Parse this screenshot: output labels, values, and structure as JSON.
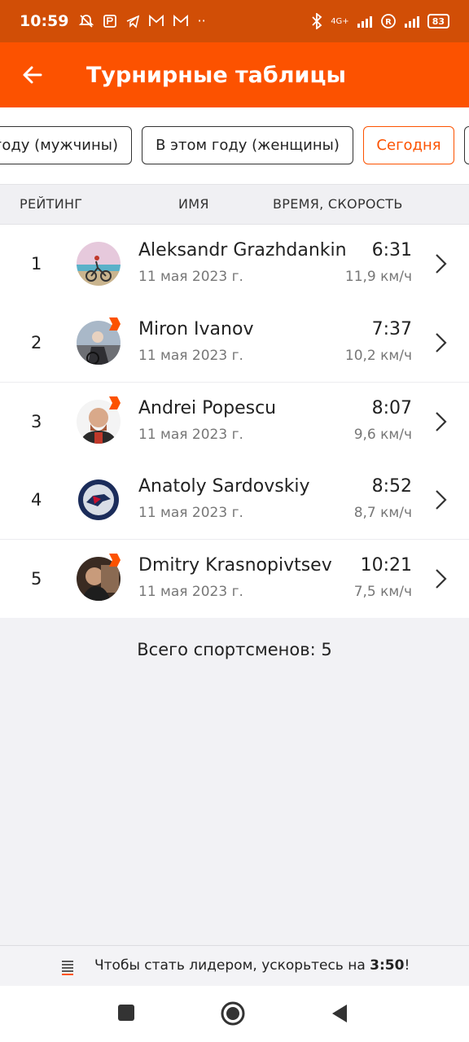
{
  "status_bar": {
    "time": "10:59",
    "network": "4G+",
    "battery": "83"
  },
  "app_bar": {
    "title": "Турнирные таблицы"
  },
  "filters": [
    {
      "label": "году (мужчины)",
      "active": false
    },
    {
      "label": "В этом году (женщины)",
      "active": false
    },
    {
      "label": "Сегодня",
      "active": true
    }
  ],
  "table": {
    "headers": {
      "rank": "РЕЙТИНГ",
      "name": "ИМЯ",
      "result": "ВРЕМЯ, СКОРОСТЬ"
    },
    "rows": [
      {
        "rank": "1",
        "name": "Aleksandr Grazhdankin",
        "date": "11 мая 2023 г.",
        "time": "6:31",
        "speed": "11,9 км/ч"
      },
      {
        "rank": "2",
        "name": "Miron Ivanov",
        "date": "11 мая 2023 г.",
        "time": "7:37",
        "speed": "10,2 км/ч"
      },
      {
        "rank": "3",
        "name": "Andrei Popescu",
        "date": "11 мая 2023 г.",
        "time": "8:07",
        "speed": "9,6 км/ч"
      },
      {
        "rank": "4",
        "name": "Anatoly Sardovskiy",
        "date": "11 мая 2023 г.",
        "time": "8:52",
        "speed": "8,7 км/ч"
      },
      {
        "rank": "5",
        "name": "Dmitry Krasnopivtsev",
        "date": "11 мая 2023 г.",
        "time": "10:21",
        "speed": "7,5 км/ч"
      }
    ],
    "total": "Всего спортсменов: 5"
  },
  "banner": {
    "text": "Чтобы стать лидером, ускорьтесь на ",
    "highlight": "3:50",
    "suffix": "!"
  },
  "colors": {
    "accent": "#fc5200",
    "status_bar": "#d14e06"
  }
}
